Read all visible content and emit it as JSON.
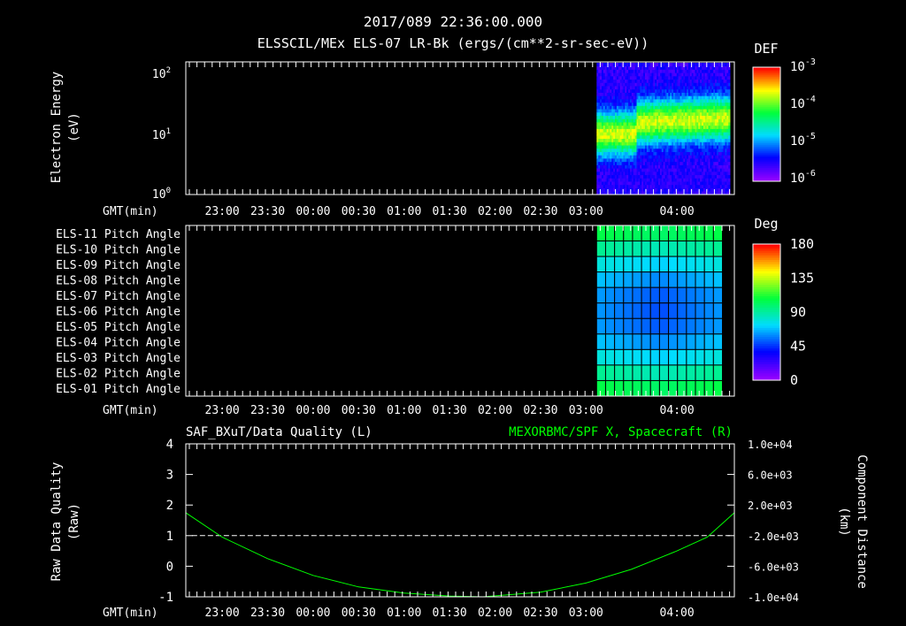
{
  "header": {
    "timestamp": "2017/089 22:36:00.000",
    "title": "ELSSCIL/MEx ELS-07 LR-Bk  (ergs/(cm**2-sr-sec-eV))"
  },
  "time_axis": {
    "label": "GMT(min)",
    "ticks": [
      "23:00",
      "23:30",
      "00:00",
      "00:30",
      "01:00",
      "01:30",
      "02:00",
      "02:30",
      "03:00",
      "04:00"
    ]
  },
  "colors": {
    "background": "#000000",
    "axis": "#ffffff",
    "spacecraft_line": "#00ff00",
    "quality_line": "#ffffff",
    "right_title": "#00ff00"
  },
  "chart_data": [
    {
      "type": "heatmap",
      "ylabel": "Electron Energy",
      "yunit": "(eV)",
      "yscale": "log",
      "ylim": [
        1,
        150
      ],
      "y_ticks": [
        1,
        10,
        100
      ],
      "colorbar": {
        "title": "DEF",
        "scale": "log",
        "ticks": [
          "10^-3",
          "10^-4",
          "10^-5",
          "10^-6"
        ],
        "range": [
          1e-06,
          0.001
        ]
      },
      "data_start": "03:07",
      "data_end": "04:35"
    },
    {
      "type": "heatmap",
      "rows": [
        "ELS-11 Pitch Angle",
        "ELS-10 Pitch Angle",
        "ELS-09 Pitch Angle",
        "ELS-08 Pitch Angle",
        "ELS-07 Pitch Angle",
        "ELS-06 Pitch Angle",
        "ELS-05 Pitch Angle",
        "ELS-04 Pitch Angle",
        "ELS-03 Pitch Angle",
        "ELS-02 Pitch Angle",
        "ELS-01 Pitch Angle"
      ],
      "colorbar": {
        "title": "Deg",
        "ticks": [
          180,
          135,
          90,
          45,
          0
        ],
        "range": [
          0,
          180
        ]
      },
      "data_start": "03:07",
      "data_end": "04:30",
      "approx_degrees": [
        100,
        85,
        70,
        58,
        50,
        48,
        50,
        58,
        70,
        85,
        100
      ]
    },
    {
      "type": "line",
      "left_title": "SAF_BXuT/Data Quality (L)",
      "right_title": "MEXORBMC/SPF X, Spacecraft (R)",
      "ylabel_left": "Raw Data Quality",
      "yunit_left": "(Raw)",
      "ylim_left": [
        -1,
        4
      ],
      "yticks_left": [
        4,
        3,
        2,
        1,
        0,
        -1
      ],
      "ylabel_right": "Component Distance",
      "yunit_right": "(km)",
      "ylim_right": [
        -10000,
        10000
      ],
      "yticks_right": [
        "1.0e+04",
        "6.0e+03",
        "2.0e+03",
        "-2.0e+03",
        "-6.0e+03",
        "-1.0e+04"
      ],
      "series": [
        {
          "name": "SAF_BXuT/Data Quality",
          "axis": "left",
          "x": [
            "22:40",
            "04:35"
          ],
          "values": [
            1,
            1
          ]
        },
        {
          "name": "MEXORBMC/SPF X, Spacecraft",
          "axis": "right",
          "x": [
            "22:36",
            "23:00",
            "23:30",
            "00:00",
            "00:30",
            "01:00",
            "01:30",
            "01:52",
            "02:30",
            "03:00",
            "03:30",
            "04:00",
            "04:20",
            "04:42"
          ],
          "values": [
            1000,
            -2200,
            -5000,
            -7200,
            -8700,
            -9500,
            -9900,
            -10000,
            -9400,
            -8200,
            -6400,
            -4000,
            -2200,
            1000
          ]
        }
      ]
    }
  ]
}
